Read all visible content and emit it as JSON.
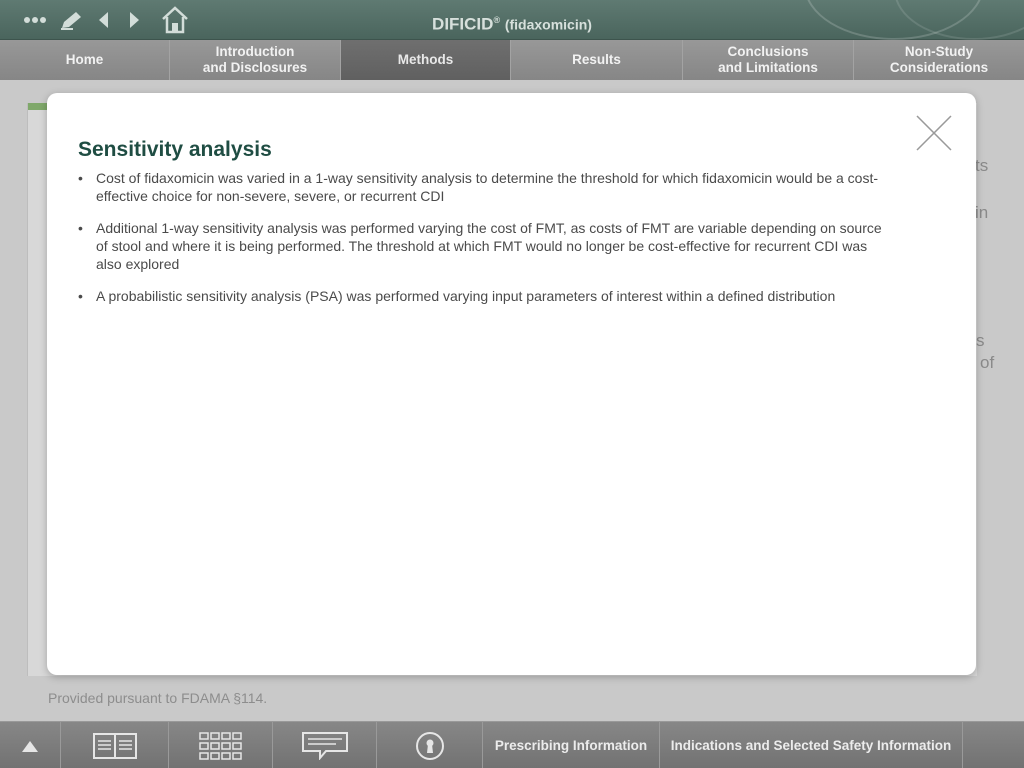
{
  "header": {
    "title_brand": "DIFICID",
    "title_reg": "®",
    "title_sub": "(fidaxomicin)",
    "icons": [
      "more-icon",
      "pencil-icon",
      "back-icon",
      "forward-icon",
      "home-icon"
    ]
  },
  "nav": {
    "tabs": [
      {
        "label_line1": "Home",
        "label_line2": ""
      },
      {
        "label_line1": "Introduction",
        "label_line2": "and Disclosures"
      },
      {
        "label_line1": "Methods",
        "label_line2": "",
        "active": true
      },
      {
        "label_line1": "Results",
        "label_line2": ""
      },
      {
        "label_line1": "Conclusions",
        "label_line2": "and Limitations"
      },
      {
        "label_line1": "Non-Study",
        "label_line2": "Considerations"
      }
    ]
  },
  "background": {
    "fragments": [
      "ts",
      "in",
      "s",
      "of"
    ],
    "footer_note": "Provided pursuant to FDAMA §114."
  },
  "modal": {
    "title": "Sensitivity analysis",
    "bullets": [
      "Cost of fidaxomicin was varied in a 1-way sensitivity analysis to determine the threshold for which fidaxomicin would be a cost-effective choice for non-severe, severe, or recurrent CDI",
      "Additional 1-way sensitivity analysis was performed varying the cost of FMT, as costs of FMT are variable depending on source of stool and where it is being performed. The threshold at which FMT would no longer be cost-effective for recurrent CDI was also explored",
      "A probabilistic sensitivity analysis (PSA) was performed varying input parameters of interest within a defined distribution"
    ]
  },
  "bottombar": {
    "prescribing_label": "Prescribing Information",
    "isi_label": "Indications and Selected Safety Information"
  },
  "colors": {
    "title_green": "#1f4d43",
    "header_green": "#4a655d",
    "accent_green": "#7fa86a"
  }
}
